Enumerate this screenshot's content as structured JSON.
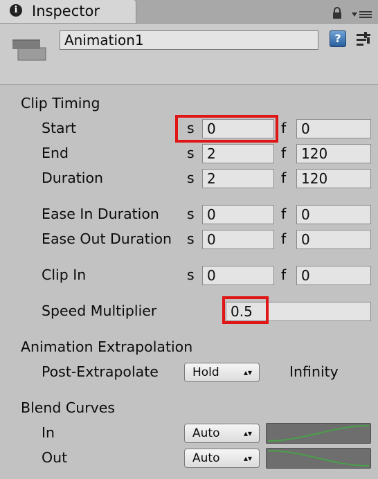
{
  "tab": {
    "title": "Inspector"
  },
  "header": {
    "asset_name": "Animation1"
  },
  "clip_timing": {
    "title": "Clip Timing",
    "rows": [
      {
        "label": "Start",
        "s_unit": "s",
        "s_value": "0",
        "f_unit": "f",
        "f_value": "0"
      },
      {
        "label": "End",
        "s_unit": "s",
        "s_value": "2",
        "f_unit": "f",
        "f_value": "120"
      },
      {
        "label": "Duration",
        "s_unit": "s",
        "s_value": "2",
        "f_unit": "f",
        "f_value": "120"
      },
      {
        "label": "Ease In Duration",
        "s_unit": "s",
        "s_value": "0",
        "f_unit": "f",
        "f_value": "0"
      },
      {
        "label": "Ease Out Duration",
        "s_unit": "s",
        "s_value": "0",
        "f_unit": "f",
        "f_value": "0"
      },
      {
        "label": "Clip In",
        "s_unit": "s",
        "s_value": "0",
        "f_unit": "f",
        "f_value": "0"
      }
    ],
    "speed_multiplier": {
      "label": "Speed Multiplier",
      "value": "0.5"
    }
  },
  "extrapolation": {
    "title": "Animation Extrapolation",
    "post_label": "Post-Extrapolate",
    "post_value": "Hold",
    "post_result": "Infinity"
  },
  "blend_curves": {
    "title": "Blend Curves",
    "in": {
      "label": "In",
      "value": "Auto"
    },
    "out": {
      "label": "Out",
      "value": "Auto"
    }
  },
  "colors": {
    "highlight": "#e01616",
    "curve_line": "#4aa04a",
    "panel": "#c2c2c2"
  }
}
